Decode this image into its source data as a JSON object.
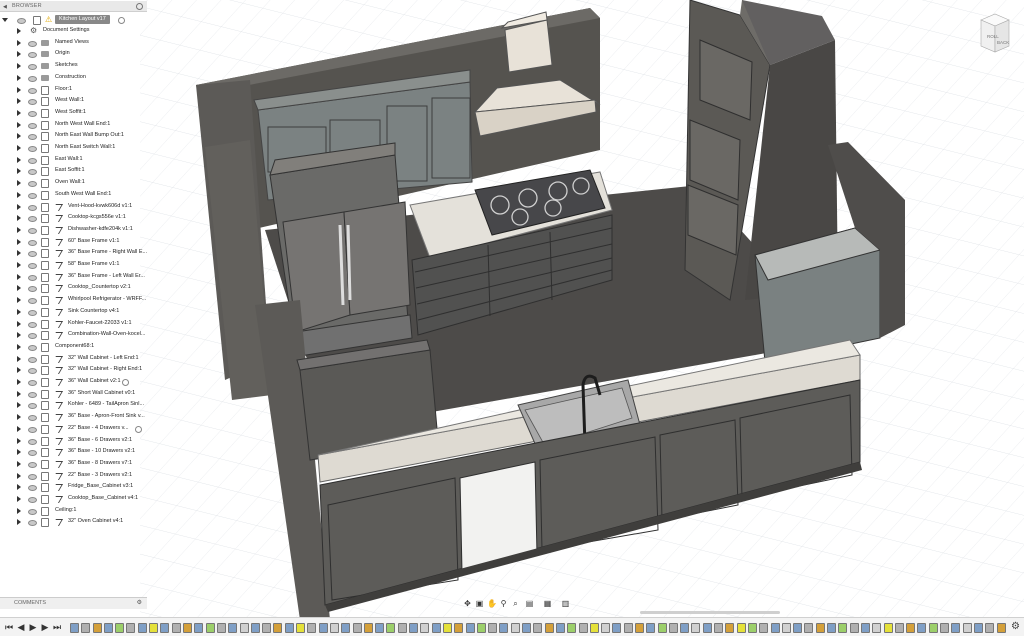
{
  "browser": {
    "title": "BROWSER",
    "document": "Kitchen Layout v17",
    "items": [
      {
        "label": "Document Settings",
        "kind": "settings",
        "indent": 1
      },
      {
        "label": "Named Views",
        "kind": "folder",
        "indent": 1
      },
      {
        "label": "Origin",
        "kind": "folder",
        "indent": 2
      },
      {
        "label": "Sketches",
        "kind": "folder",
        "indent": 2
      },
      {
        "label": "Construction",
        "kind": "folder",
        "indent": 2
      },
      {
        "label": "Floor:1",
        "kind": "body",
        "indent": 2
      },
      {
        "label": "West Wall:1",
        "kind": "body",
        "indent": 2
      },
      {
        "label": "West Soffit:1",
        "kind": "body",
        "indent": 2
      },
      {
        "label": "North West Wall End:1",
        "kind": "body",
        "indent": 2
      },
      {
        "label": "North East Wall Bump Out:1",
        "kind": "body",
        "indent": 2
      },
      {
        "label": "North East Switch Wall:1",
        "kind": "body",
        "indent": 2
      },
      {
        "label": "East Wall:1",
        "kind": "body",
        "indent": 2
      },
      {
        "label": "East Soffit:1",
        "kind": "body",
        "indent": 2
      },
      {
        "label": "Oven Wall:1",
        "kind": "body",
        "indent": 2
      },
      {
        "label": "South West Wall End:1",
        "kind": "body",
        "indent": 2
      },
      {
        "label": "Vent-Hood-kvwk606d v1:1",
        "kind": "link",
        "indent": 3
      },
      {
        "label": "Cooktop-kcgs556e v1:1",
        "kind": "link",
        "indent": 3
      },
      {
        "label": "Dishwasher-kdfe204k v1:1",
        "kind": "link",
        "indent": 3
      },
      {
        "label": "60\" Base Frame v1:1",
        "kind": "link",
        "indent": 3
      },
      {
        "label": "36\" Base Frame - Right Wall E...",
        "kind": "link",
        "indent": 3
      },
      {
        "label": "58\" Base Frame v1:1",
        "kind": "link",
        "indent": 3
      },
      {
        "label": "36\" Base Frame - Left Wall Er...",
        "kind": "link",
        "indent": 3
      },
      {
        "label": "Cooktop_Countertop v2:1",
        "kind": "link",
        "indent": 3
      },
      {
        "label": "Whirlpool Refrigerator - WRFF...",
        "kind": "link",
        "indent": 3
      },
      {
        "label": "Sink Countertop v4:1",
        "kind": "link",
        "indent": 3
      },
      {
        "label": "Kohler-Faucet-22033 v1:1",
        "kind": "link",
        "indent": 3
      },
      {
        "label": "Combination-Wall-Oven-kocel...",
        "kind": "link",
        "indent": 3
      },
      {
        "label": "Component68:1",
        "kind": "body",
        "indent": 2
      },
      {
        "label": "32\" Wall Cabinet - Left End:1",
        "kind": "link",
        "indent": 3
      },
      {
        "label": "32\" Wall Cabinet - Right End:1",
        "kind": "link",
        "indent": 3
      },
      {
        "label": "36\" Wall Cabinet v2:1",
        "kind": "link",
        "indent": 3,
        "circle": true
      },
      {
        "label": "36\" Short Wall Cabinet v0:1",
        "kind": "link",
        "indent": 3
      },
      {
        "label": "Kohler - 6489 - TailApron Sinl...",
        "kind": "link",
        "indent": 3
      },
      {
        "label": "36\" Base - Apron-Front Sink v...",
        "kind": "link",
        "indent": 3
      },
      {
        "label": "22\" Base - 4 Drawers v...",
        "kind": "link",
        "indent": 3,
        "circle": true
      },
      {
        "label": "36\" Base - 6 Drawers v2:1",
        "kind": "link",
        "indent": 3
      },
      {
        "label": "36\" Base - 10 Drawers v2:1",
        "kind": "link",
        "indent": 3
      },
      {
        "label": "36\" Base - 8 Drawers v7:1",
        "kind": "link",
        "indent": 3
      },
      {
        "label": "22\" Base - 3 Drawers v2:1",
        "kind": "link",
        "indent": 3
      },
      {
        "label": "Fridge_Base_Cabinet v3:1",
        "kind": "link",
        "indent": 3
      },
      {
        "label": "Cooktop_Base_Cabinet v4:1",
        "kind": "link",
        "indent": 3
      },
      {
        "label": "Ceiling:1",
        "kind": "body",
        "indent": 2
      },
      {
        "label": "32\" Oven Cabinet v4:1",
        "kind": "link",
        "indent": 3
      }
    ]
  },
  "comments": {
    "title": "COMMENTS"
  },
  "viewcube": {
    "top": "ROLL",
    "front": "BACK"
  },
  "navbar": {
    "icons": [
      "orbit-icon",
      "look-at-icon",
      "pan-icon",
      "zoom-icon",
      "fit-icon",
      "display-settings-icon",
      "grid-settings-icon"
    ]
  },
  "timeline": {
    "controls": [
      "first",
      "previous",
      "play",
      "next",
      "last"
    ]
  },
  "colors": {
    "panel": "#f3f3f3",
    "selection": "#7d7d7d",
    "cabinet": "#5a5956",
    "cabinet_light": "#7a8181",
    "countertop": "#e6e4dd",
    "wall": "#555453",
    "floor": "#4f4d4b",
    "grid": "#dcdfe3"
  }
}
